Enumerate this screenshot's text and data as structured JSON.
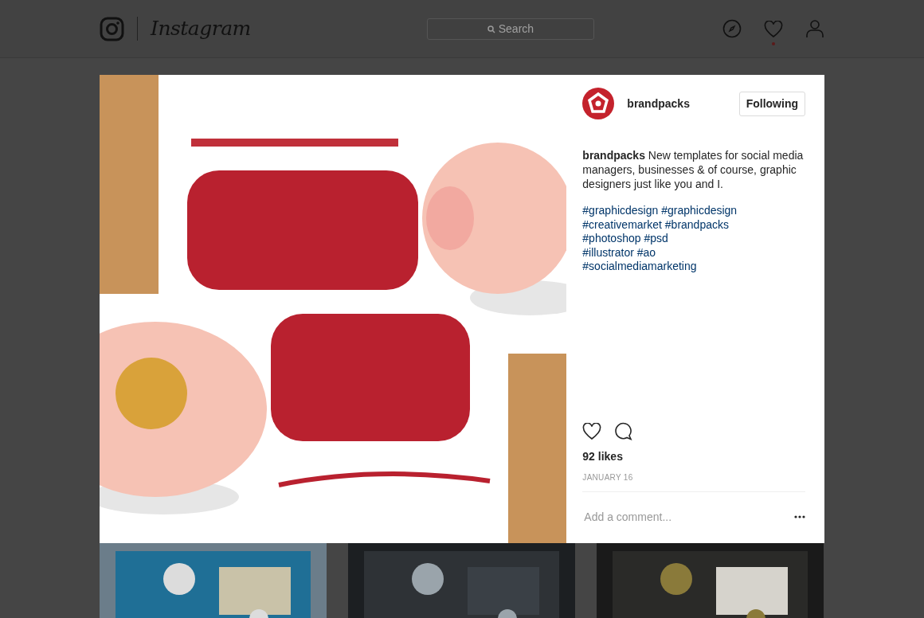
{
  "header": {
    "logo_text": "Instagram",
    "search": {
      "placeholder": "Search"
    },
    "activity_notification": true
  },
  "post": {
    "author": "brandpacks",
    "follow_button": "Following",
    "caption": {
      "author": "brandpacks",
      "text": "New templates for social media managers, businesses & of course, graphic designers just like you and I."
    },
    "hashtag_lines": [
      "#graphicdesign #graphicdesign",
      "#creativemarket #brandpacks",
      "#photoshop #psd",
      "#illustrator #ao",
      "#socialmediamarketing"
    ],
    "liked": false,
    "likes": "92 likes",
    "date": "JANUARY 16",
    "comment": {
      "placeholder": "Add a comment..."
    }
  }
}
